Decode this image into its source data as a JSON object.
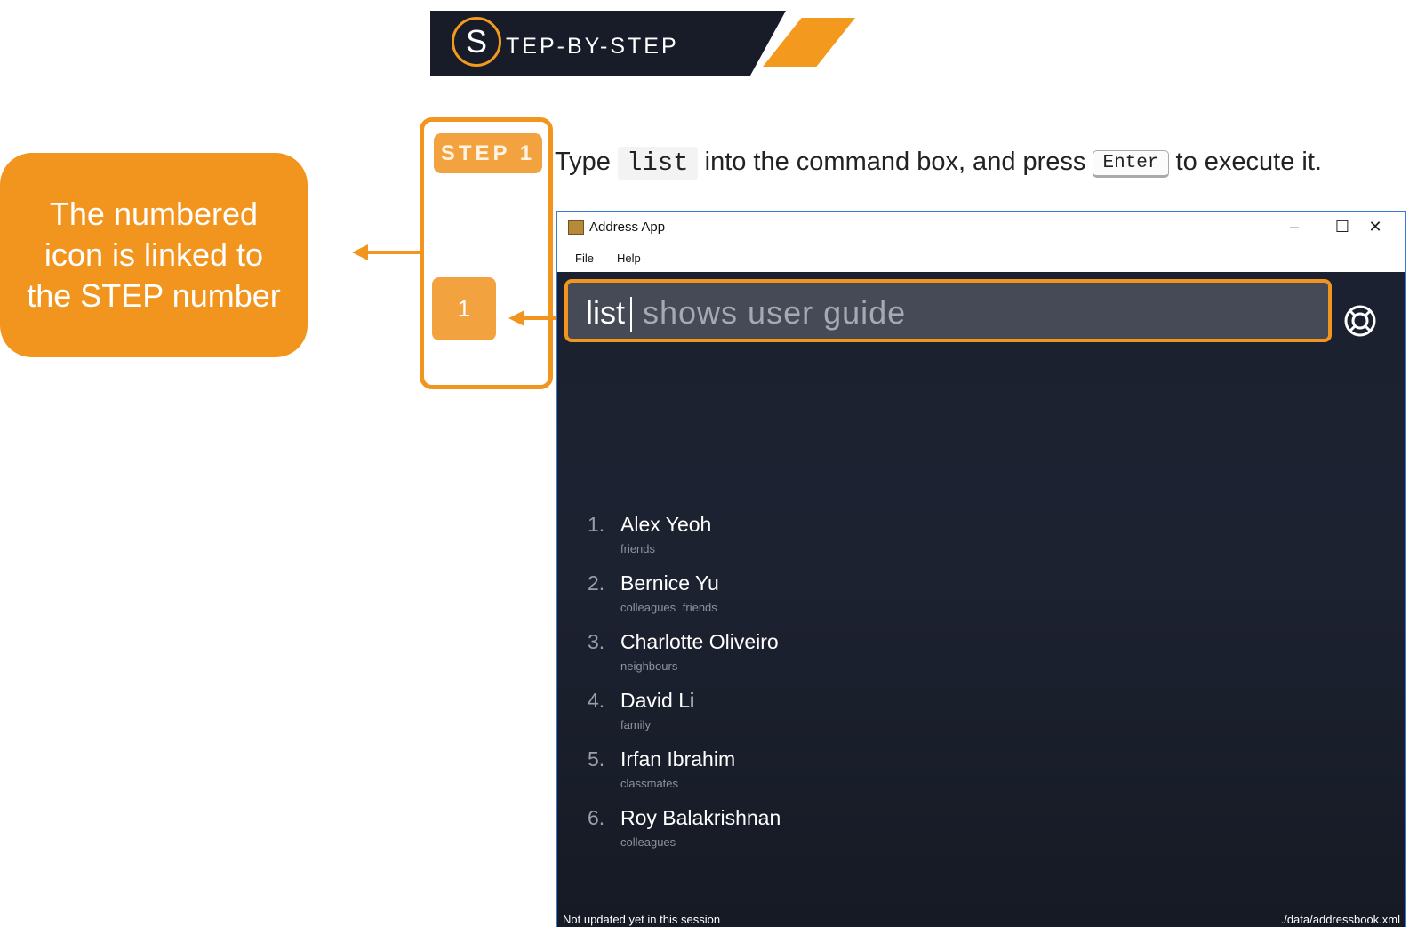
{
  "banner": {
    "letter": "S",
    "text": "TEP-BY-STEP"
  },
  "callout": {
    "text": "The numbered icon is linked to the STEP number"
  },
  "step": {
    "pill_label": "STEP 1",
    "number_label": "1"
  },
  "instruction": {
    "before": "Type ",
    "code": "list",
    "middle": " into the command box, and press ",
    "key": "Enter",
    "after": " to execute it."
  },
  "window": {
    "title": "Address App",
    "minimize_glyph": "–",
    "maximize_glyph": "☐",
    "close_glyph": "✕",
    "menu": [
      "File",
      "Help"
    ],
    "command": {
      "typed": "list",
      "placeholder": "shows user guide"
    },
    "help_icon": "lifebuoy-icon",
    "persons": [
      {
        "num": "1.",
        "name": "Alex Yeoh",
        "tags": "friends"
      },
      {
        "num": "2.",
        "name": "Bernice Yu",
        "tags": "colleagues friends"
      },
      {
        "num": "3.",
        "name": "Charlotte Oliveiro",
        "tags": "neighbours"
      },
      {
        "num": "4.",
        "name": "David Li",
        "tags": "family"
      },
      {
        "num": "5.",
        "name": "Irfan Ibrahim",
        "tags": "classmates"
      },
      {
        "num": "6.",
        "name": "Roy Balakrishnan",
        "tags": "colleagues"
      }
    ],
    "status": {
      "left": "Not updated yet in this session",
      "right": "./data/addressbook.xml"
    }
  },
  "colors": {
    "accent": "#f2951e",
    "app_background": "#1b2130",
    "banner_background": "#171c28"
  }
}
